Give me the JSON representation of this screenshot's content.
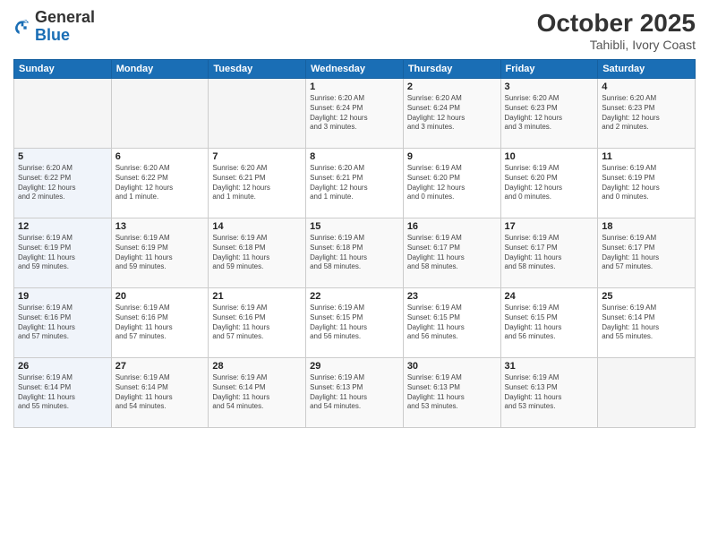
{
  "header": {
    "logo_general": "General",
    "logo_blue": "Blue",
    "month_year": "October 2025",
    "location": "Tahibli, Ivory Coast"
  },
  "days_of_week": [
    "Sunday",
    "Monday",
    "Tuesday",
    "Wednesday",
    "Thursday",
    "Friday",
    "Saturday"
  ],
  "weeks": [
    [
      {
        "day": "",
        "info": ""
      },
      {
        "day": "",
        "info": ""
      },
      {
        "day": "",
        "info": ""
      },
      {
        "day": "1",
        "info": "Sunrise: 6:20 AM\nSunset: 6:24 PM\nDaylight: 12 hours\nand 3 minutes."
      },
      {
        "day": "2",
        "info": "Sunrise: 6:20 AM\nSunset: 6:24 PM\nDaylight: 12 hours\nand 3 minutes."
      },
      {
        "day": "3",
        "info": "Sunrise: 6:20 AM\nSunset: 6:23 PM\nDaylight: 12 hours\nand 3 minutes."
      },
      {
        "day": "4",
        "info": "Sunrise: 6:20 AM\nSunset: 6:23 PM\nDaylight: 12 hours\nand 2 minutes."
      }
    ],
    [
      {
        "day": "5",
        "info": "Sunrise: 6:20 AM\nSunset: 6:22 PM\nDaylight: 12 hours\nand 2 minutes."
      },
      {
        "day": "6",
        "info": "Sunrise: 6:20 AM\nSunset: 6:22 PM\nDaylight: 12 hours\nand 1 minute."
      },
      {
        "day": "7",
        "info": "Sunrise: 6:20 AM\nSunset: 6:21 PM\nDaylight: 12 hours\nand 1 minute."
      },
      {
        "day": "8",
        "info": "Sunrise: 6:20 AM\nSunset: 6:21 PM\nDaylight: 12 hours\nand 1 minute."
      },
      {
        "day": "9",
        "info": "Sunrise: 6:19 AM\nSunset: 6:20 PM\nDaylight: 12 hours\nand 0 minutes."
      },
      {
        "day": "10",
        "info": "Sunrise: 6:19 AM\nSunset: 6:20 PM\nDaylight: 12 hours\nand 0 minutes."
      },
      {
        "day": "11",
        "info": "Sunrise: 6:19 AM\nSunset: 6:19 PM\nDaylight: 12 hours\nand 0 minutes."
      }
    ],
    [
      {
        "day": "12",
        "info": "Sunrise: 6:19 AM\nSunset: 6:19 PM\nDaylight: 11 hours\nand 59 minutes."
      },
      {
        "day": "13",
        "info": "Sunrise: 6:19 AM\nSunset: 6:19 PM\nDaylight: 11 hours\nand 59 minutes."
      },
      {
        "day": "14",
        "info": "Sunrise: 6:19 AM\nSunset: 6:18 PM\nDaylight: 11 hours\nand 59 minutes."
      },
      {
        "day": "15",
        "info": "Sunrise: 6:19 AM\nSunset: 6:18 PM\nDaylight: 11 hours\nand 58 minutes."
      },
      {
        "day": "16",
        "info": "Sunrise: 6:19 AM\nSunset: 6:17 PM\nDaylight: 11 hours\nand 58 minutes."
      },
      {
        "day": "17",
        "info": "Sunrise: 6:19 AM\nSunset: 6:17 PM\nDaylight: 11 hours\nand 58 minutes."
      },
      {
        "day": "18",
        "info": "Sunrise: 6:19 AM\nSunset: 6:17 PM\nDaylight: 11 hours\nand 57 minutes."
      }
    ],
    [
      {
        "day": "19",
        "info": "Sunrise: 6:19 AM\nSunset: 6:16 PM\nDaylight: 11 hours\nand 57 minutes."
      },
      {
        "day": "20",
        "info": "Sunrise: 6:19 AM\nSunset: 6:16 PM\nDaylight: 11 hours\nand 57 minutes."
      },
      {
        "day": "21",
        "info": "Sunrise: 6:19 AM\nSunset: 6:16 PM\nDaylight: 11 hours\nand 57 minutes."
      },
      {
        "day": "22",
        "info": "Sunrise: 6:19 AM\nSunset: 6:15 PM\nDaylight: 11 hours\nand 56 minutes."
      },
      {
        "day": "23",
        "info": "Sunrise: 6:19 AM\nSunset: 6:15 PM\nDaylight: 11 hours\nand 56 minutes."
      },
      {
        "day": "24",
        "info": "Sunrise: 6:19 AM\nSunset: 6:15 PM\nDaylight: 11 hours\nand 56 minutes."
      },
      {
        "day": "25",
        "info": "Sunrise: 6:19 AM\nSunset: 6:14 PM\nDaylight: 11 hours\nand 55 minutes."
      }
    ],
    [
      {
        "day": "26",
        "info": "Sunrise: 6:19 AM\nSunset: 6:14 PM\nDaylight: 11 hours\nand 55 minutes."
      },
      {
        "day": "27",
        "info": "Sunrise: 6:19 AM\nSunset: 6:14 PM\nDaylight: 11 hours\nand 54 minutes."
      },
      {
        "day": "28",
        "info": "Sunrise: 6:19 AM\nSunset: 6:14 PM\nDaylight: 11 hours\nand 54 minutes."
      },
      {
        "day": "29",
        "info": "Sunrise: 6:19 AM\nSunset: 6:13 PM\nDaylight: 11 hours\nand 54 minutes."
      },
      {
        "day": "30",
        "info": "Sunrise: 6:19 AM\nSunset: 6:13 PM\nDaylight: 11 hours\nand 53 minutes."
      },
      {
        "day": "31",
        "info": "Sunrise: 6:19 AM\nSunset: 6:13 PM\nDaylight: 11 hours\nand 53 minutes."
      },
      {
        "day": "",
        "info": ""
      }
    ]
  ]
}
